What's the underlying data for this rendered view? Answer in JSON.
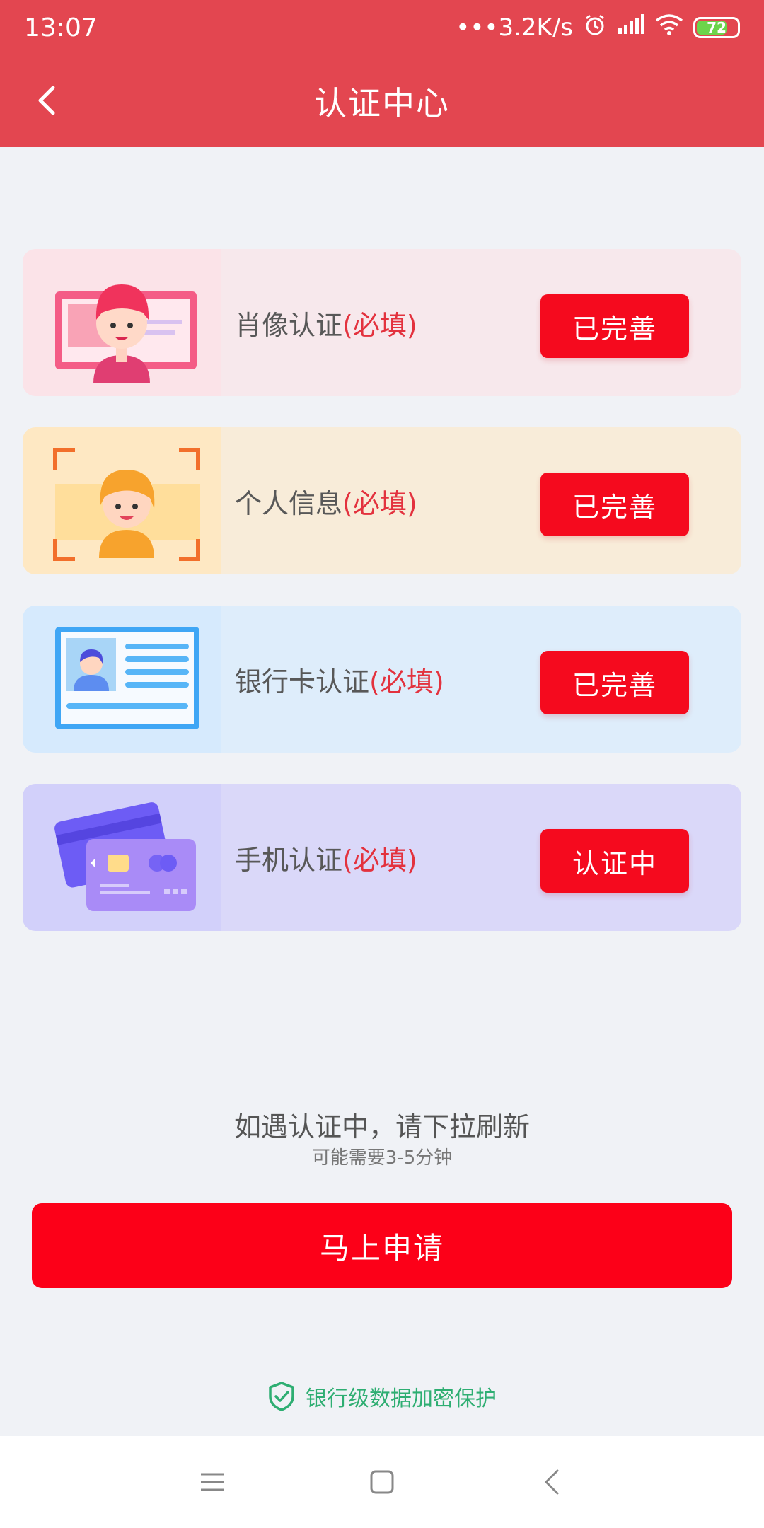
{
  "status_bar": {
    "time": "13:07",
    "speed": "•••3.2K/s",
    "battery": "72"
  },
  "nav": {
    "title": "认证中心"
  },
  "cards": [
    {
      "label": "肖像认证",
      "required": "(必填)",
      "status": "已完善",
      "icon": "portrait-icon"
    },
    {
      "label": "个人信息",
      "required": "(必填)",
      "status": "已完善",
      "icon": "personal-info-icon"
    },
    {
      "label": "银行卡认证",
      "required": "(必填)",
      "status": "已完善",
      "icon": "id-card-icon"
    },
    {
      "label": "手机认证",
      "required": "(必填)",
      "status": "认证中",
      "icon": "credit-card-icon"
    }
  ],
  "tips": {
    "main": "如遇认证中，请下拉刷新",
    "sub": "可能需要3-5分钟"
  },
  "apply_button": "马上申请",
  "security_note": "银行级数据加密保护",
  "colors": {
    "header": "#E34650",
    "button_red": "#F50A1E",
    "required_text": "#E3323E",
    "secure_green": "#2EAE72"
  }
}
